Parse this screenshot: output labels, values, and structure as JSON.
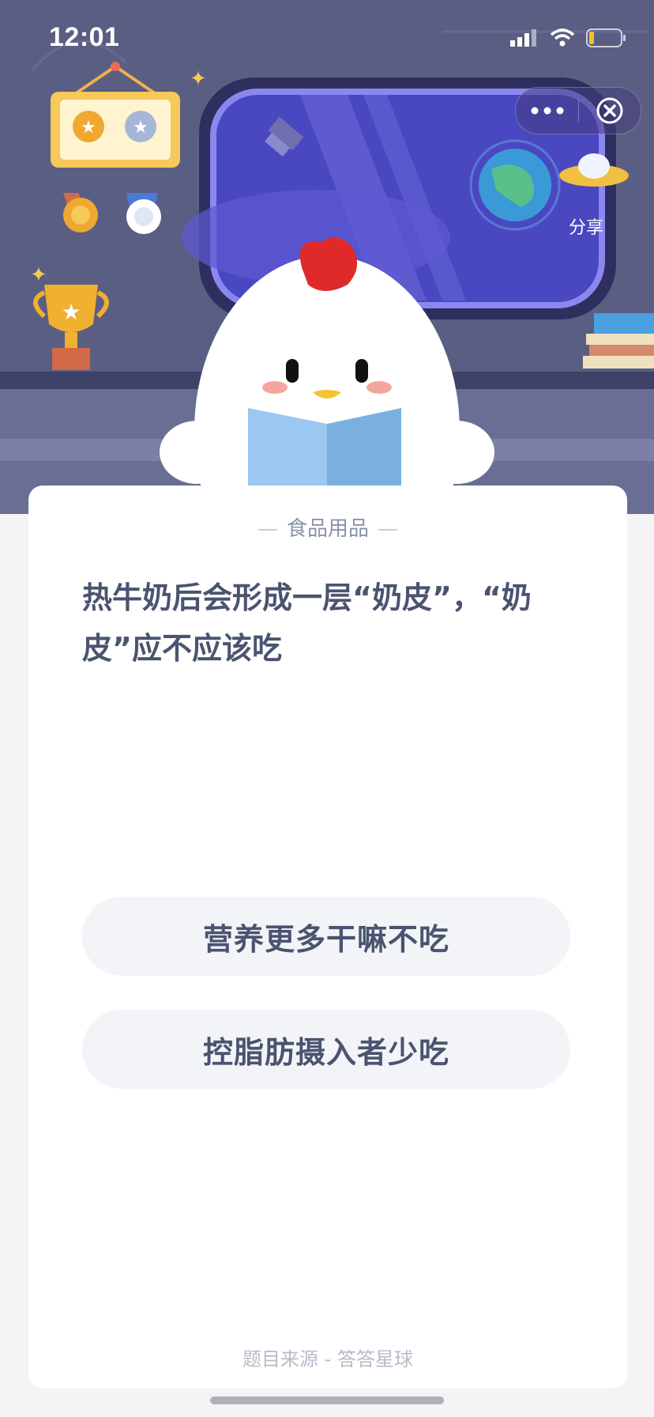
{
  "status_bar": {
    "time": "12:01"
  },
  "hero": {
    "share_label": "分享"
  },
  "nav": {
    "more_icon": "more-dots-icon",
    "close_icon": "close-circle-icon"
  },
  "quiz": {
    "category": "食品用品",
    "question": "热牛奶后会形成一层“奶皮”，“奶皮”应不应该吃",
    "options": [
      "营养更多干嘛不吃",
      "控脂肪摄入者少吃"
    ],
    "source": "题目来源 - 答答星球"
  },
  "colors": {
    "hero_bg": "#5a5e82",
    "window_blue": "#4a48c0",
    "text": "#4a5470",
    "option_bg": "#f3f4f7"
  }
}
